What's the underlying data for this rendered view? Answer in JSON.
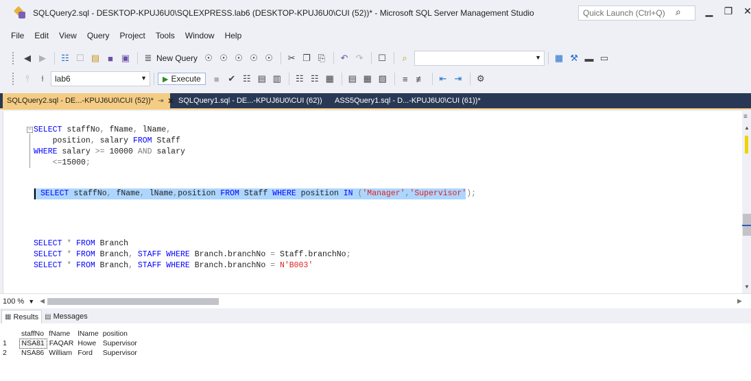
{
  "window": {
    "title": "SQLQuery2.sql - DESKTOP-KPUJ6U0\\SQLEXPRESS.lab6 (DESKTOP-KPUJ6U0\\CUI (52))* - Microsoft SQL Server Management Studio",
    "quick_launch_placeholder": "Quick Launch (Ctrl+Q)"
  },
  "menu": [
    "File",
    "Edit",
    "View",
    "Query",
    "Project",
    "Tools",
    "Window",
    "Help"
  ],
  "toolbar": {
    "new_query_label": "New Query",
    "database": "lab6",
    "execute_label": "Execute"
  },
  "tabs": [
    {
      "label": "SQLQuery2.sql - DE...-KPUJ6U0\\CUI (52))*",
      "active": true
    },
    {
      "label": "SQLQuery1.sql - DE...-KPUJ6U0\\CUI (62))",
      "active": false
    },
    {
      "label": "ASS5Query1.sql - D...-KPUJ6U0\\CUI (61))*",
      "active": false
    }
  ],
  "editor": {
    "lines": [
      "SELECT staffNo, fName, lName,",
      "    position, salary FROM Staff",
      "WHERE salary >= 10000 AND salary",
      "    <=15000;",
      "SELECT staffNo, fName, lName,position FROM Staff WHERE position IN ('Manager','Supervisor');",
      "SELECT * FROM Branch",
      "SELECT * FROM Branch, STAFF WHERE Branch.branchNo = Staff.branchNo;",
      "SELECT * FROM Branch, STAFF WHERE Branch.branchNo = N'B003'"
    ]
  },
  "status": {
    "zoom": "100 %"
  },
  "results": {
    "tabs": [
      "Results",
      "Messages"
    ],
    "columns": [
      "staffNo",
      "fName",
      "lName",
      "position"
    ],
    "rows": [
      {
        "n": "1",
        "cells": [
          "NSA81",
          "FAQAR",
          "Howe",
          "Supervisor"
        ]
      },
      {
        "n": "2",
        "cells": [
          "NSA86",
          "William",
          "Ford",
          "Supervisor"
        ]
      }
    ]
  }
}
